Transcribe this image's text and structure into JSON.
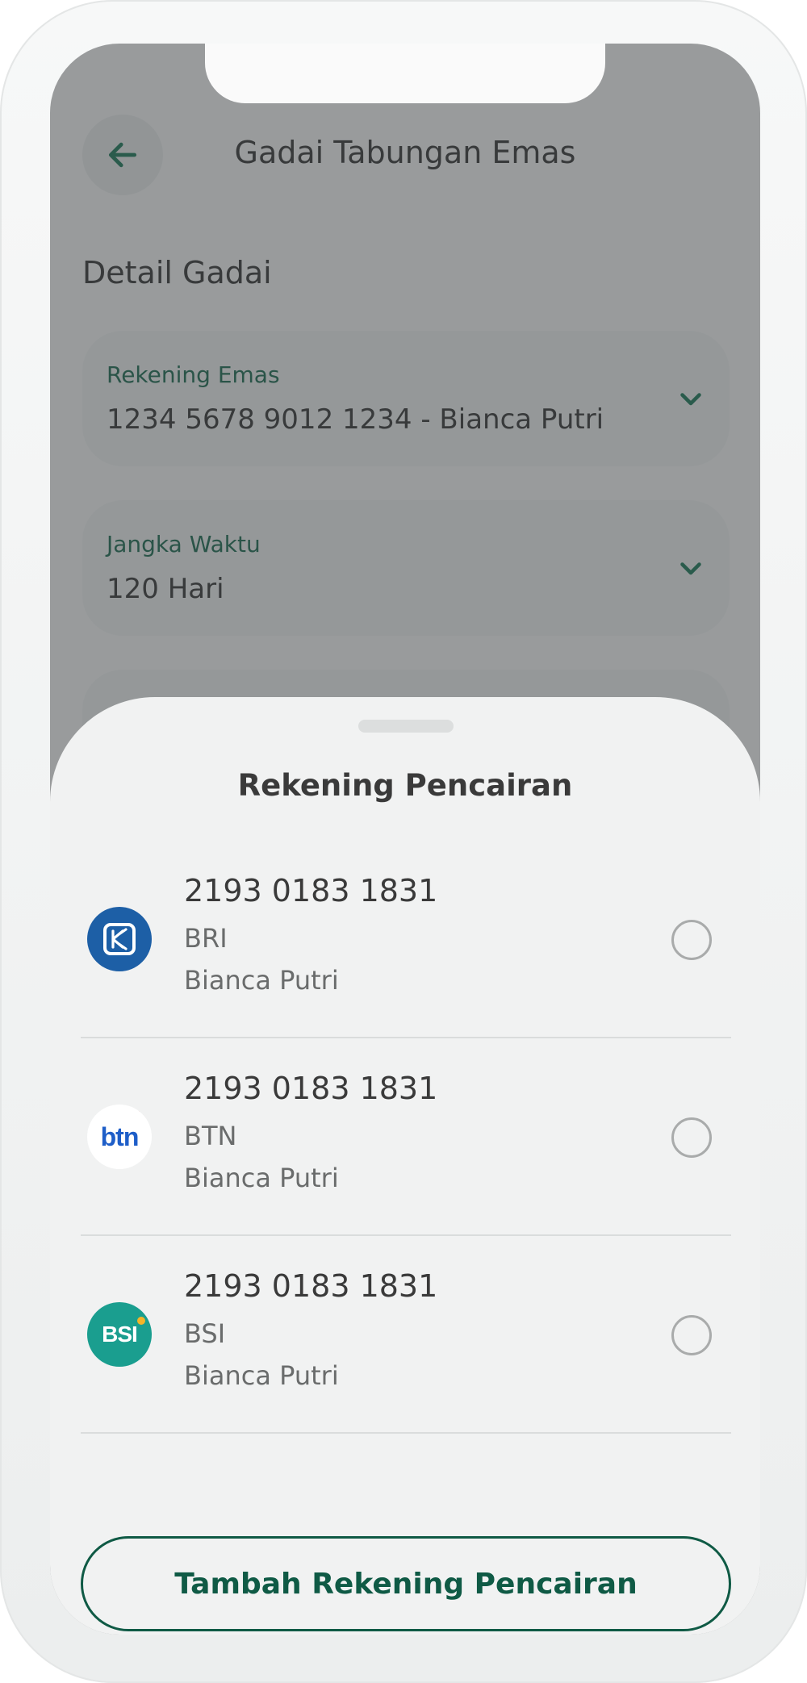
{
  "header": {
    "title": "Gadai Tabungan Emas",
    "back_icon": "arrow-left-icon"
  },
  "section": {
    "title": "Detail Gadai"
  },
  "fields": [
    {
      "label": "Rekening Emas",
      "value": "1234 5678 9012 1234 - Bianca Putri"
    },
    {
      "label": "Jangka Waktu",
      "value": "120 Hari"
    }
  ],
  "sheet": {
    "title": "Rekening Pencairan",
    "accounts": [
      {
        "number": "2193 0183 1831",
        "bank": "BRI",
        "name": "Bianca Putri",
        "logo": "bri-logo-icon",
        "selected": false
      },
      {
        "number": "2193 0183 1831",
        "bank": "BTN",
        "name": "Bianca Putri",
        "logo": "btn-logo-icon",
        "logo_text": "btn",
        "selected": false
      },
      {
        "number": "2193 0183 1831",
        "bank": "BSI",
        "name": "Bianca Putri",
        "logo": "bsi-logo-icon",
        "logo_text": "BSI",
        "selected": false
      }
    ],
    "add_button_label": "Tambah Rekening Pencairan"
  },
  "colors": {
    "primary": "#0f5a45",
    "accent_green": "#1f6b53",
    "bri_blue": "#1d5fa6",
    "bsi_teal": "#1a9e8f",
    "btn_blue": "#1e5ec8"
  }
}
